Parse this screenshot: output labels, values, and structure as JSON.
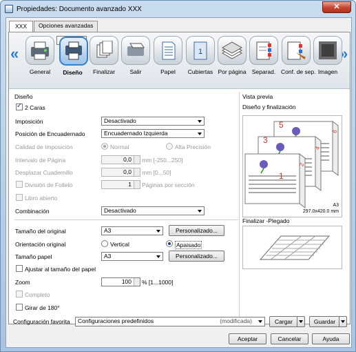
{
  "window": {
    "title": "Propiedades: Documento avanzado XXX",
    "close": "✕"
  },
  "tabs": [
    "XXX",
    "Opciones avanzadas"
  ],
  "ribbon": {
    "prev": "«",
    "next": "»",
    "items": [
      "General",
      "Diseño",
      "Finalizar",
      "Salir",
      "Papel",
      "Cubiertas",
      "Por página",
      "Separad.",
      "Conf. de sep.",
      "Imagen"
    ]
  },
  "design": {
    "section_title": "Diseño",
    "two_sided": "2 Caras",
    "imposition_label": "Imposición",
    "imposition_value": "Desactivado",
    "binding_pos_label": "Posición de Encuadernado",
    "binding_pos_value": "Encuadernado Izquierda",
    "print_quality_label": "Calidad de Imposición",
    "quality_normal": "Normal",
    "quality_high": "Alta Precisión",
    "page_interval_label": "Intervalo de Página",
    "page_interval_value": "0,0",
    "page_interval_unit": "mm [-250...250]",
    "shift_label": "Desplazar Cuadernillo",
    "shift_value": "0,0",
    "shift_unit": "mm [0...50]",
    "booklet_split_label": "División de Folleto",
    "booklet_split_value": "1",
    "booklet_split_unit": "Páginas por sección",
    "open_book": "Libro abierto",
    "combination_label": "Combinación",
    "combination_value": "Desactivado"
  },
  "paper": {
    "original_size_label": "Tamaño del original",
    "original_size_value": "A3",
    "custom1": "Personalizado...",
    "orientation_label": "Orientación original",
    "orient_portrait": "Vertical",
    "orient_landscape": "Apaisado",
    "paper_size_label": "Tamaño papel",
    "paper_size_value": "A3",
    "custom2": "Personalizado...",
    "fit_to_paper": "Ajustar al tamaño del papel",
    "zoom_label": "Zoom",
    "zoom_value": "100",
    "zoom_unit": "% [1...1000]",
    "full": "Completo",
    "rotate180": "Girar de 180°"
  },
  "preview": {
    "title": "Vista previa",
    "design_finish": "Diseño y finalización",
    "paper_info_line1": "A3",
    "paper_info_line2": "297.0x420.0 mm",
    "finish_fold": "Finalizar -Plegado",
    "page_numbers": [
      "5",
      "3",
      "1",
      "6",
      "4",
      "2"
    ]
  },
  "favorites": {
    "label": "Configuración favorita",
    "value": "Configuraciones predefinidos",
    "modified": "(modificada)",
    "load": "Cargar",
    "save": "Guardar"
  },
  "footer": {
    "accept": "Aceptar",
    "cancel": "Cancelar",
    "help": "Ayuda"
  },
  "colors": {
    "accent": "#3c80c8",
    "page_number": "#c0392b",
    "flower": "#6b5bb8"
  }
}
